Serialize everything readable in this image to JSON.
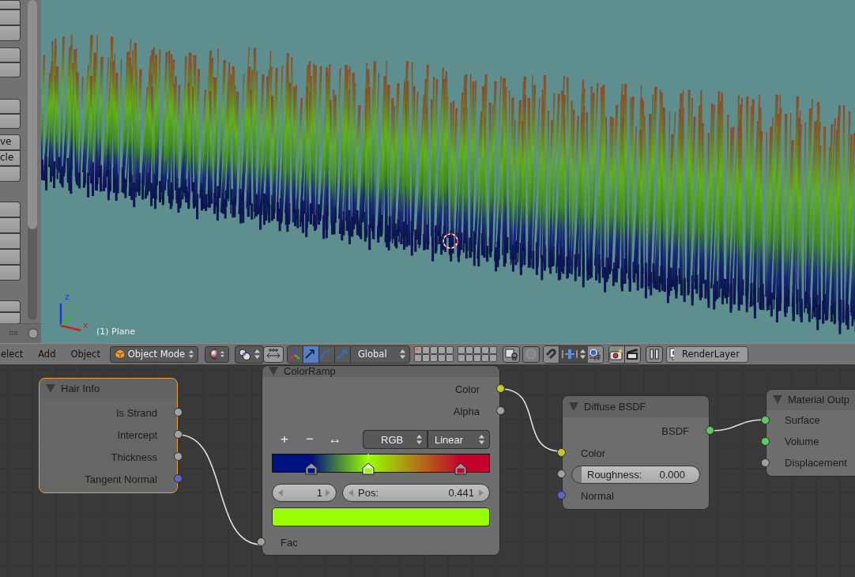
{
  "toolshelf": {
    "groups": [
      {
        "buttons": [
          {
            "kind": "blank"
          },
          {
            "kind": "blank"
          },
          {
            "kind": "blank"
          }
        ]
      },
      {
        "buttons": [
          {
            "kind": "blank"
          },
          {
            "kind": "blank"
          }
        ]
      },
      {
        "buttons": [
          {
            "kind": "blank"
          },
          {
            "kind": "blank"
          }
        ]
      },
      {
        "buttons": [
          {
            "kind": "text",
            "label": "ve"
          },
          {
            "kind": "text",
            "label": "cle"
          },
          {
            "kind": "blank"
          }
        ]
      },
      {
        "buttons": [
          {
            "kind": "blank"
          },
          {
            "kind": "blank"
          },
          {
            "kind": "blank"
          },
          {
            "kind": "blank"
          },
          {
            "kind": "blank"
          }
        ]
      },
      {
        "buttons": [
          {
            "kind": "blank"
          },
          {
            "kind": "blank"
          }
        ]
      }
    ]
  },
  "viewport": {
    "object_label": "(1) Plane",
    "axes": [
      {
        "label": "z",
        "color": "#2233dd"
      },
      {
        "label": "y",
        "color": "#33bb33"
      },
      {
        "label": "x",
        "color": "#cc2222"
      }
    ]
  },
  "header": {
    "menus": [
      {
        "label": "elect"
      },
      {
        "label": "Add"
      },
      {
        "label": "Object"
      }
    ],
    "mode": "Object Mode",
    "transform_tools": [
      {
        "kind": "translate",
        "selected": true
      },
      {
        "kind": "rotate",
        "selected": false
      },
      {
        "kind": "scale",
        "selected": false
      }
    ],
    "orientation": "Global",
    "render_layer": "RenderLayer"
  },
  "nodes": [
    {
      "title": "Hair Info",
      "selected": true,
      "rows": [
        {
          "kind": "output",
          "label": "Is Strand",
          "color": "#a1a1a1"
        },
        {
          "kind": "output",
          "label": "Intercept",
          "color": "#a1a1a1"
        },
        {
          "kind": "output",
          "label": "Thickness",
          "color": "#a1a1a1"
        },
        {
          "kind": "output",
          "label": "Tangent Normal",
          "color": "#6363c7"
        }
      ]
    },
    {
      "title": "ColorRamp",
      "selected": false,
      "rows": [
        {
          "kind": "output",
          "label": "Color",
          "color": "#c7c729"
        },
        {
          "kind": "output",
          "label": "Alpha",
          "color": "#a1a1a1"
        },
        {
          "kind": "ramp",
          "tools": [
            "+",
            "−",
            "↔"
          ],
          "color_mode": "RGB",
          "interpolation": "Linear",
          "stops": [
            {
              "level": 0.18,
              "color": "#001080",
              "selected": false
            },
            {
              "level": 0.441,
              "color": "#99ff00",
              "selected": true
            },
            {
              "level": 0.87,
              "color": "#c4002c",
              "selected": false
            }
          ],
          "index": "1",
          "pos_label": "Pos:",
          "pos_value": "0.441",
          "color": "#99ff00"
        },
        {
          "kind": "input",
          "label": "Fac",
          "color": "#a1a1a1"
        }
      ]
    },
    {
      "title": "Diffuse BSDF",
      "selected": false,
      "rows": [
        {
          "kind": "output",
          "label": "BSDF",
          "color": "#63c763"
        },
        {
          "kind": "input",
          "label": "Color",
          "color": "#c7c729"
        },
        {
          "kind": "field",
          "label": "Roughness:",
          "value": "0.000",
          "color": "#a1a1a1"
        },
        {
          "kind": "input",
          "label": "Normal",
          "color": "#6363c7"
        }
      ]
    },
    {
      "title": "Material Outp",
      "selected": false,
      "rows": [
        {
          "kind": "input",
          "label": "Surface",
          "color": "#63c763"
        },
        {
          "kind": "input",
          "label": "Volume",
          "color": "#63c763"
        },
        {
          "kind": "input",
          "label": "Displacement",
          "color": "#a1a1a1"
        }
      ]
    }
  ]
}
